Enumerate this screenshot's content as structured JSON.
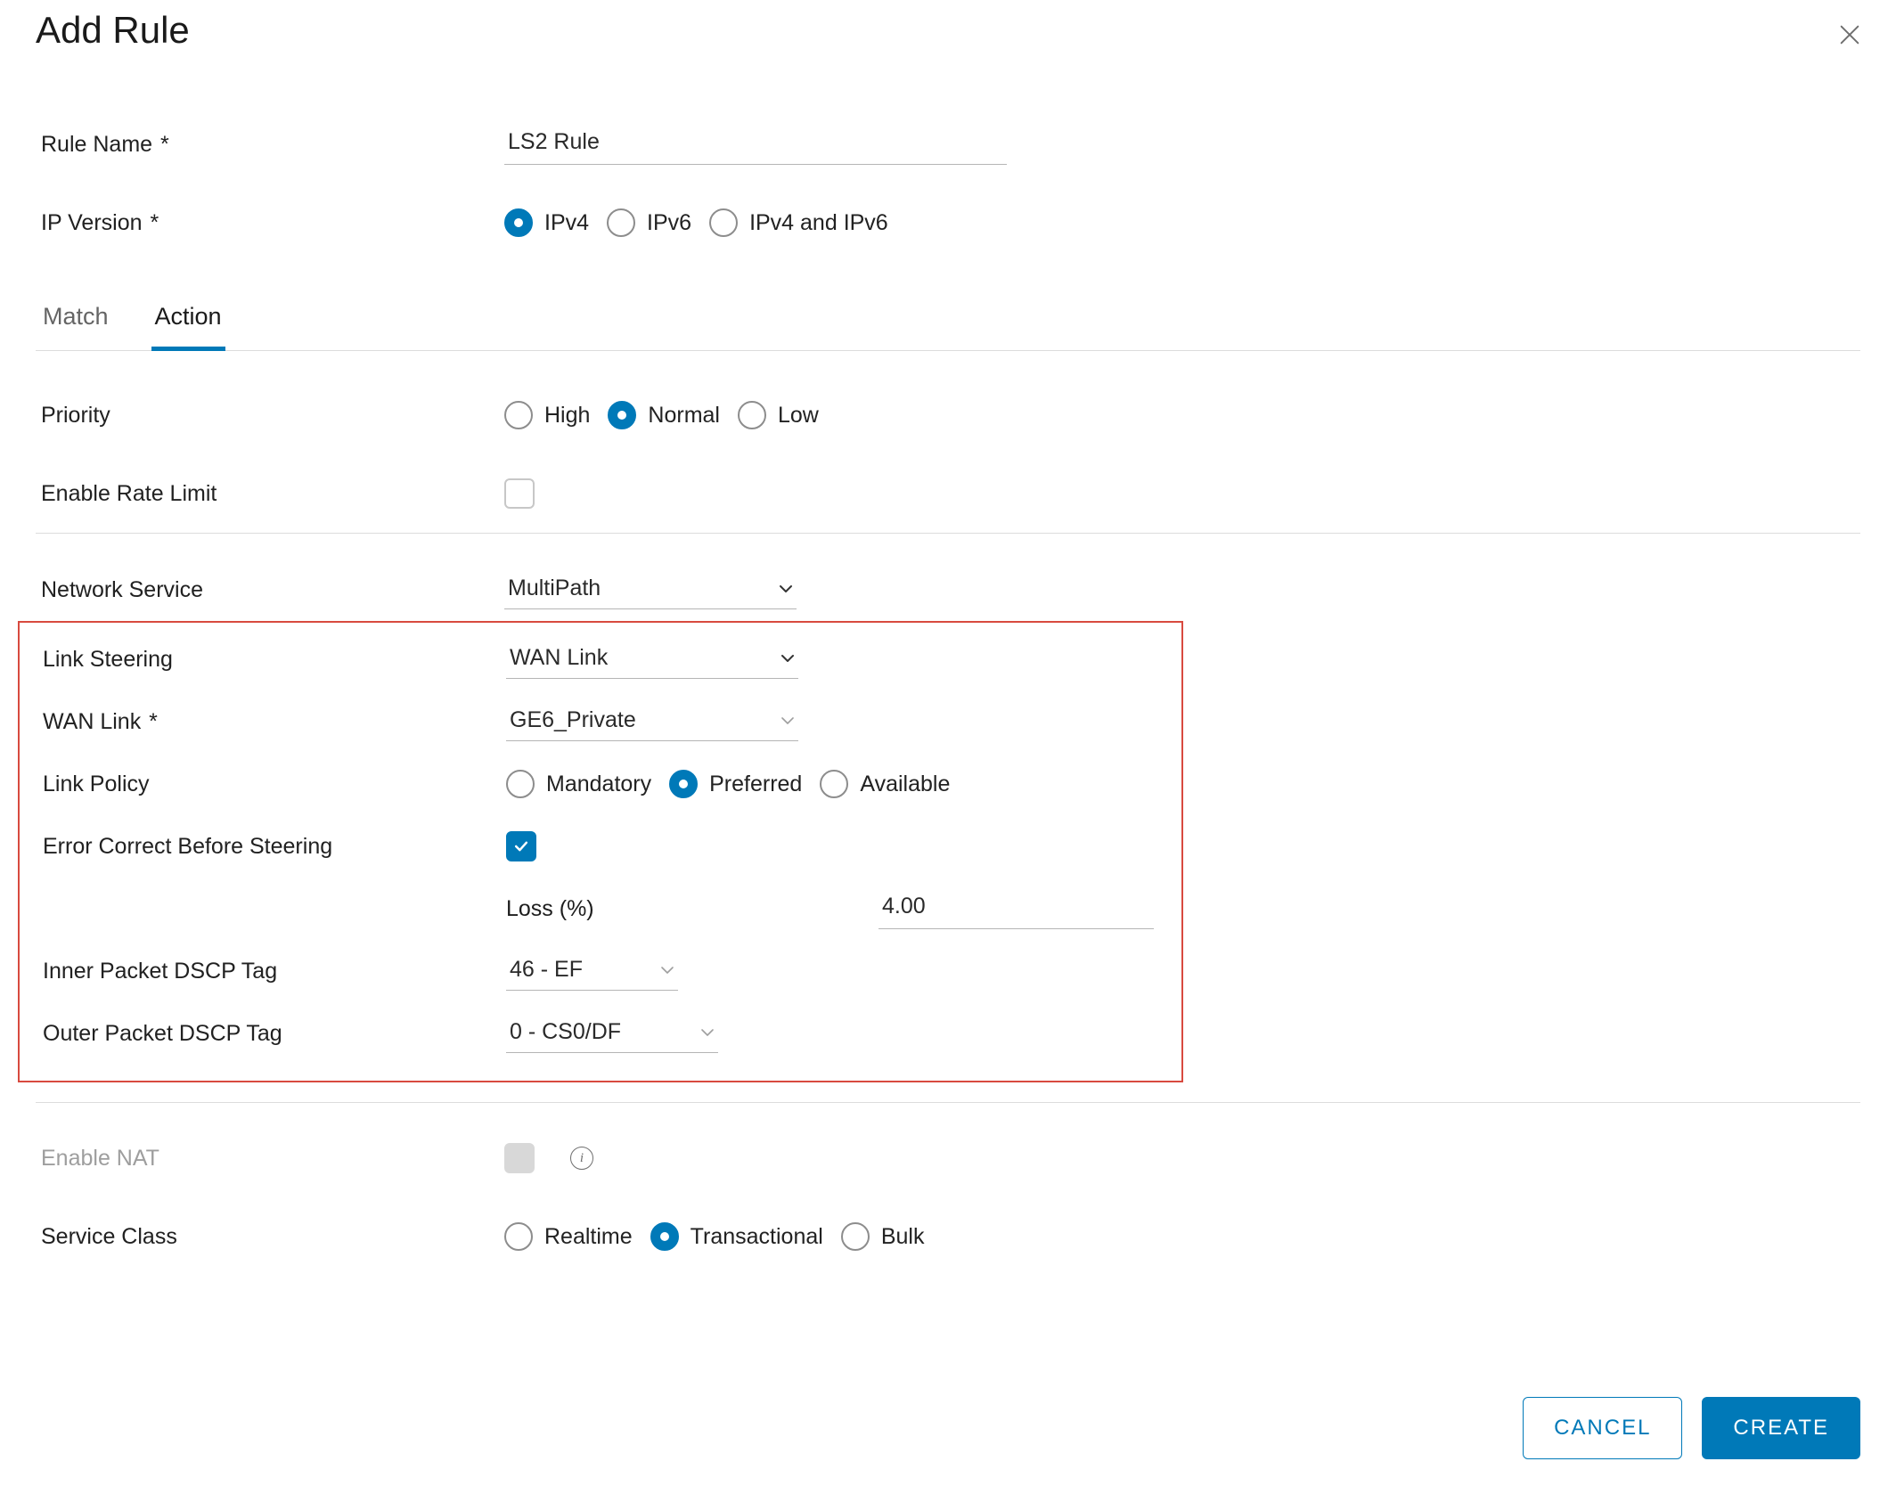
{
  "dialog": {
    "title": "Add Rule"
  },
  "fields": {
    "rule_name": {
      "label": "Rule Name",
      "req": "*",
      "value": "LS2 Rule"
    },
    "ip_version": {
      "label": "IP Version",
      "req": "*",
      "options": {
        "v4": "IPv4",
        "v6": "IPv6",
        "both": "IPv4 and IPv6"
      },
      "selected": "v4"
    }
  },
  "tabs": {
    "match": "Match",
    "action": "Action",
    "active": "action"
  },
  "action": {
    "priority": {
      "label": "Priority",
      "options": {
        "high": "High",
        "normal": "Normal",
        "low": "Low"
      },
      "selected": "normal"
    },
    "rate_limit": {
      "label": "Enable Rate Limit",
      "checked": false
    },
    "network_service": {
      "label": "Network Service",
      "value": "MultiPath"
    },
    "link_steering": {
      "label": "Link Steering",
      "value": "WAN Link"
    },
    "wan_link": {
      "label": "WAN Link",
      "req": "*",
      "value": "GE6_Private"
    },
    "link_policy": {
      "label": "Link Policy",
      "options": {
        "mandatory": "Mandatory",
        "preferred": "Preferred",
        "available": "Available"
      },
      "selected": "preferred"
    },
    "error_correct": {
      "label": "Error Correct Before Steering",
      "checked": true
    },
    "loss": {
      "label": "Loss (%)",
      "value": "4.00"
    },
    "inner_dscp": {
      "label": "Inner Packet DSCP Tag",
      "value": "46 - EF"
    },
    "outer_dscp": {
      "label": "Outer Packet DSCP Tag",
      "value": "0 - CS0/DF"
    },
    "enable_nat": {
      "label": "Enable NAT",
      "checked": false,
      "disabled": true
    },
    "service_class": {
      "label": "Service Class",
      "options": {
        "realtime": "Realtime",
        "transactional": "Transactional",
        "bulk": "Bulk"
      },
      "selected": "transactional"
    }
  },
  "footer": {
    "cancel": "CANCEL",
    "create": "CREATE"
  }
}
